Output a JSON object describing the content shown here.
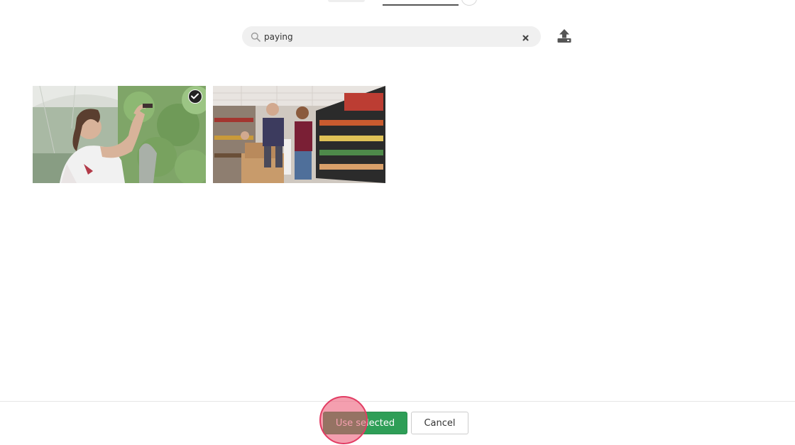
{
  "search": {
    "value": "paying",
    "placeholder": ""
  },
  "icons": {
    "search": "search-icon",
    "clear": "close-icon",
    "upload": "upload-icon",
    "selected": "checkmark-icon"
  },
  "results": [
    {
      "description": "photo",
      "selected": true
    },
    {
      "description": "photo",
      "selected": false
    }
  ],
  "footer": {
    "use_selected_label": "Use selected",
    "cancel_label": "Cancel"
  },
  "colors": {
    "primary_button": "#2e9e57",
    "click_marker": "#e23c63",
    "search_background": "#f0f0f0"
  }
}
